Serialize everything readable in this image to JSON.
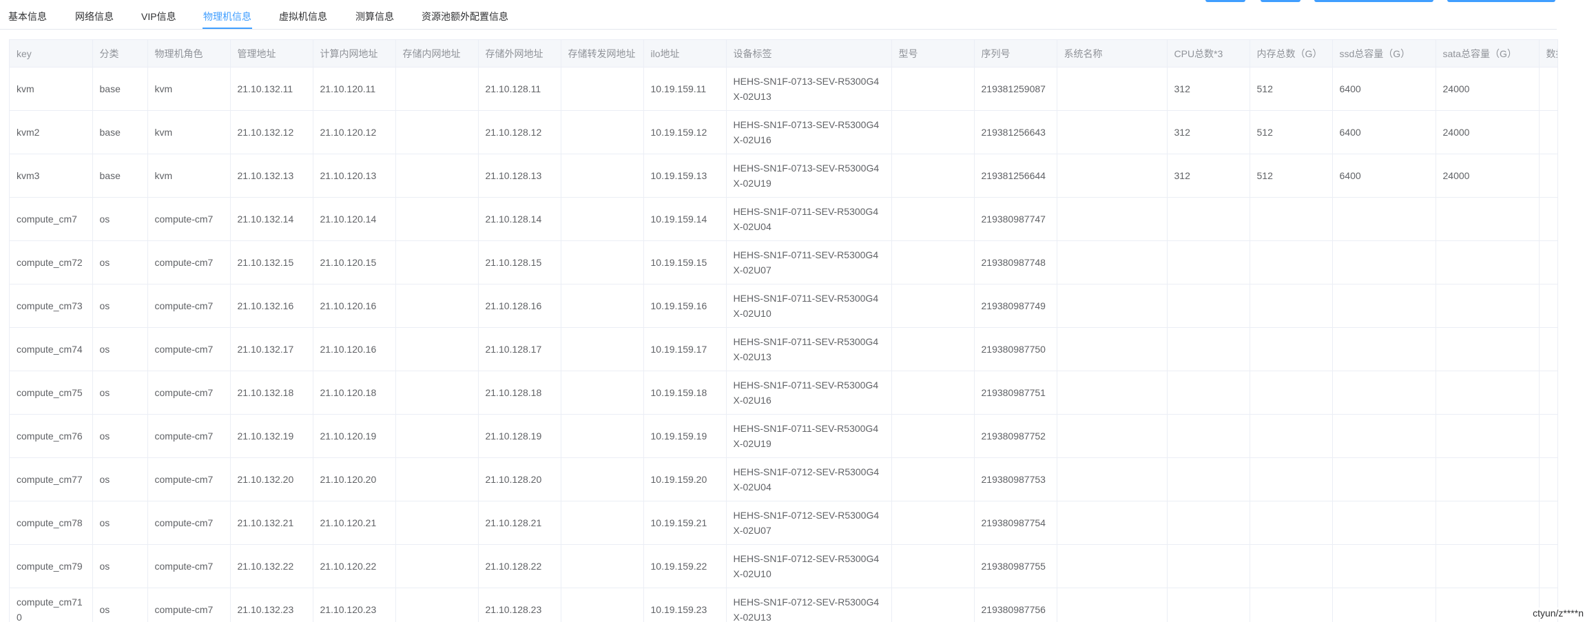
{
  "tabs": [
    {
      "label": "基本信息"
    },
    {
      "label": "网络信息"
    },
    {
      "label": "VIP信息"
    },
    {
      "label": "物理机信息"
    },
    {
      "label": "虚拟机信息"
    },
    {
      "label": "测算信息"
    },
    {
      "label": "资源池额外配置信息"
    }
  ],
  "colors": {
    "accent": "#409eff",
    "header_bg": "#f5f7fa",
    "border": "#ebeef5",
    "text": "#606266",
    "header_text": "#909399"
  },
  "table": {
    "columns": [
      "key",
      "分类",
      "物理机角色",
      "管理地址",
      "计算内网地址",
      "存储内网地址",
      "存储外网地址",
      "存储转发网地址",
      "ilo地址",
      "设备标签",
      "型号",
      "序列号",
      "系统名称",
      "CPU总数*3",
      "内存总数（G）",
      "ssd总容量（G）",
      "sata总容量（G）",
      "数据盘"
    ],
    "rows": [
      [
        "kvm",
        "base",
        "kvm",
        "21.10.132.11",
        "21.10.120.11",
        "",
        "21.10.128.11",
        "",
        "10.19.159.11",
        "HEHS-SN1F-0713-SEV-R5300G4X-02U13",
        "",
        "219381259087",
        "",
        "312",
        "512",
        "6400",
        "24000",
        ""
      ],
      [
        "kvm2",
        "base",
        "kvm",
        "21.10.132.12",
        "21.10.120.12",
        "",
        "21.10.128.12",
        "",
        "10.19.159.12",
        "HEHS-SN1F-0713-SEV-R5300G4X-02U16",
        "",
        "219381256643",
        "",
        "312",
        "512",
        "6400",
        "24000",
        ""
      ],
      [
        "kvm3",
        "base",
        "kvm",
        "21.10.132.13",
        "21.10.120.13",
        "",
        "21.10.128.13",
        "",
        "10.19.159.13",
        "HEHS-SN1F-0713-SEV-R5300G4X-02U19",
        "",
        "219381256644",
        "",
        "312",
        "512",
        "6400",
        "24000",
        ""
      ],
      [
        "compute_cm7",
        "os",
        "compute-cm7",
        "21.10.132.14",
        "21.10.120.14",
        "",
        "21.10.128.14",
        "",
        "10.19.159.14",
        "HEHS-SN1F-0711-SEV-R5300G4X-02U04",
        "",
        "219380987747",
        "",
        "",
        "",
        "",
        "",
        ""
      ],
      [
        "compute_cm72",
        "os",
        "compute-cm7",
        "21.10.132.15",
        "21.10.120.15",
        "",
        "21.10.128.15",
        "",
        "10.19.159.15",
        "HEHS-SN1F-0711-SEV-R5300G4X-02U07",
        "",
        "219380987748",
        "",
        "",
        "",
        "",
        "",
        ""
      ],
      [
        "compute_cm73",
        "os",
        "compute-cm7",
        "21.10.132.16",
        "21.10.120.16",
        "",
        "21.10.128.16",
        "",
        "10.19.159.16",
        "HEHS-SN1F-0711-SEV-R5300G4X-02U10",
        "",
        "219380987749",
        "",
        "",
        "",
        "",
        "",
        ""
      ],
      [
        "compute_cm74",
        "os",
        "compute-cm7",
        "21.10.132.17",
        "21.10.120.16",
        "",
        "21.10.128.17",
        "",
        "10.19.159.17",
        "HEHS-SN1F-0711-SEV-R5300G4X-02U13",
        "",
        "219380987750",
        "",
        "",
        "",
        "",
        "",
        ""
      ],
      [
        "compute_cm75",
        "os",
        "compute-cm7",
        "21.10.132.18",
        "21.10.120.18",
        "",
        "21.10.128.18",
        "",
        "10.19.159.18",
        "HEHS-SN1F-0711-SEV-R5300G4X-02U16",
        "",
        "219380987751",
        "",
        "",
        "",
        "",
        "",
        ""
      ],
      [
        "compute_cm76",
        "os",
        "compute-cm7",
        "21.10.132.19",
        "21.10.120.19",
        "",
        "21.10.128.19",
        "",
        "10.19.159.19",
        "HEHS-SN1F-0711-SEV-R5300G4X-02U19",
        "",
        "219380987752",
        "",
        "",
        "",
        "",
        "",
        ""
      ],
      [
        "compute_cm77",
        "os",
        "compute-cm7",
        "21.10.132.20",
        "21.10.120.20",
        "",
        "21.10.128.20",
        "",
        "10.19.159.20",
        "HEHS-SN1F-0712-SEV-R5300G4X-02U04",
        "",
        "219380987753",
        "",
        "",
        "",
        "",
        "",
        ""
      ],
      [
        "compute_cm78",
        "os",
        "compute-cm7",
        "21.10.132.21",
        "21.10.120.21",
        "",
        "21.10.128.21",
        "",
        "10.19.159.21",
        "HEHS-SN1F-0712-SEV-R5300G4X-02U07",
        "",
        "219380987754",
        "",
        "",
        "",
        "",
        "",
        ""
      ],
      [
        "compute_cm79",
        "os",
        "compute-cm7",
        "21.10.132.22",
        "21.10.120.22",
        "",
        "21.10.128.22",
        "",
        "10.19.159.22",
        "HEHS-SN1F-0712-SEV-R5300G4X-02U10",
        "",
        "219380987755",
        "",
        "",
        "",
        "",
        "",
        ""
      ],
      [
        "compute_cm710",
        "os",
        "compute-cm7",
        "21.10.132.23",
        "21.10.120.23",
        "",
        "21.10.128.23",
        "",
        "10.19.159.23",
        "HEHS-SN1F-0712-SEV-R5300G4X-02U13",
        "",
        "219380987756",
        "",
        "",
        "",
        "",
        "",
        ""
      ]
    ]
  },
  "footer": {
    "user": "ctyun/z****n"
  }
}
